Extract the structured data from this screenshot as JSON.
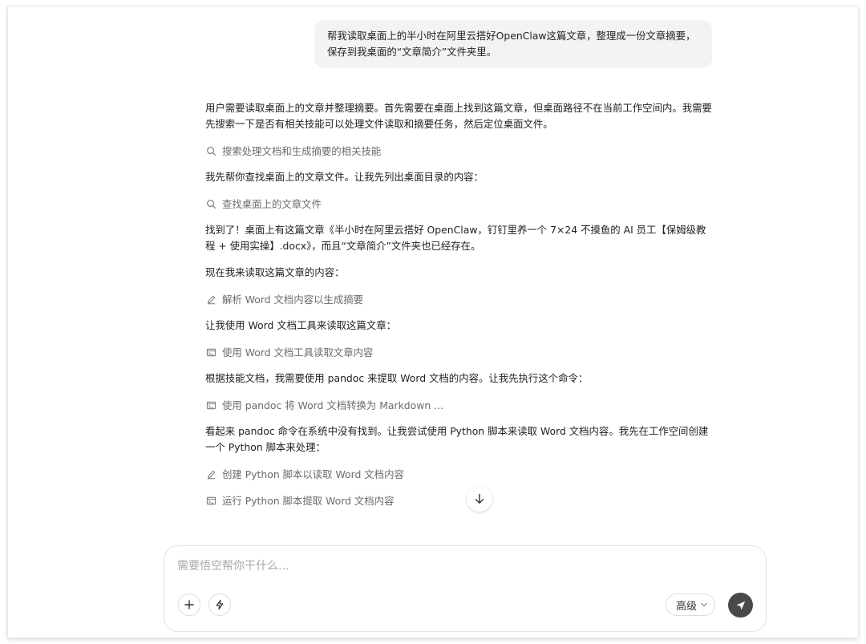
{
  "user_message": "帮我读取桌面上的半小时在阿里云搭好OpenClaw这篇文章，整理成一份文章摘要，保存到我桌面的“文章简介”文件夹里。",
  "stream": [
    {
      "kind": "text",
      "text": "用户需要读取桌面上的文章并整理摘要。首先需要在桌面上找到这篇文章，但桌面路径不在当前工作空间内。我需要先搜索一下是否有相关技能可以处理文件读取和摘要任务，然后定位桌面文件。"
    },
    {
      "kind": "tool",
      "icon": "search-icon",
      "text": "搜索处理文档和生成摘要的相关技能"
    },
    {
      "kind": "text",
      "text": "我先帮你查找桌面上的文章文件。让我先列出桌面目录的内容："
    },
    {
      "kind": "tool",
      "icon": "search-icon",
      "text": "查找桌面上的文章文件"
    },
    {
      "kind": "text",
      "text": "找到了！桌面上有这篇文章《半小时在阿里云搭好 OpenClaw，钉钉里养一个 7×24 不摸鱼的 AI 员工【保姆级教程 + 使用实操】.docx》，而且“文章简介”文件夹也已经存在。"
    },
    {
      "kind": "text",
      "text": "现在我来读取这篇文章的内容："
    },
    {
      "kind": "tool",
      "icon": "edit-icon",
      "text": "解析 Word 文档内容以生成摘要"
    },
    {
      "kind": "text",
      "text": "让我使用 Word 文档工具来读取这篇文章："
    },
    {
      "kind": "tool",
      "icon": "terminal-icon",
      "text": "使用 Word 文档工具读取文章内容"
    },
    {
      "kind": "text",
      "text": "根据技能文档，我需要使用 pandoc 来提取 Word 文档的内容。让我先执行这个命令："
    },
    {
      "kind": "tool",
      "icon": "terminal-icon",
      "text": "使用 pandoc 将 Word 文档转换为 Markdown ..."
    },
    {
      "kind": "text",
      "text": "看起来 pandoc 命令在系统中没有找到。让我尝试使用 Python 脚本来读取 Word 文档内容。我先在工作空间创建一个 Python 脚本来处理："
    },
    {
      "kind": "tool",
      "icon": "edit-icon",
      "text": "创建 Python 脚本以读取 Word 文档内容"
    },
    {
      "kind": "tool",
      "icon": "terminal-icon",
      "text": "运行 Python 脚本提取 Word 文档内容"
    }
  ],
  "composer": {
    "placeholder": "需要悟空帮你干什么...",
    "advanced_label": "高级"
  }
}
